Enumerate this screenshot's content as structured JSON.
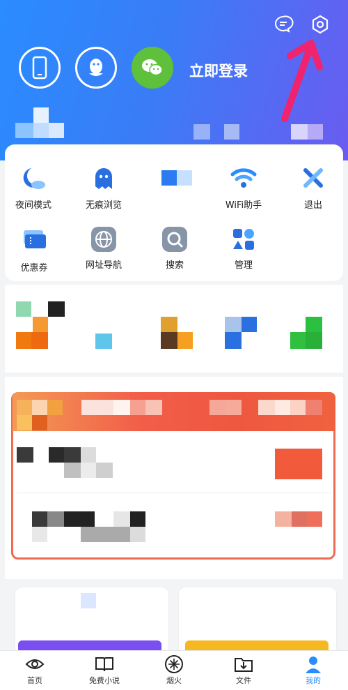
{
  "header": {
    "login_label": "立即登录"
  },
  "tools": [
    {
      "name": "night-mode",
      "label": "夜间模式",
      "icon": "moon-cloud-icon"
    },
    {
      "name": "incognito",
      "label": "无痕浏览",
      "icon": "ghost-icon"
    },
    {
      "name": "blurred",
      "label": "",
      "icon": "blurred-icon"
    },
    {
      "name": "wifi-helper",
      "label": "WiFi助手",
      "icon": "wifi-icon"
    },
    {
      "name": "exit",
      "label": "退出",
      "icon": "close-x-icon"
    },
    {
      "name": "coupons",
      "label": "优惠券",
      "icon": "coupon-icon"
    },
    {
      "name": "url-nav",
      "label": "网址导航",
      "icon": "globe-icon"
    },
    {
      "name": "search",
      "label": "搜索",
      "icon": "search-icon"
    },
    {
      "name": "manage",
      "label": "管理",
      "icon": "manage-icon"
    }
  ],
  "bottom_nav": [
    {
      "name": "home",
      "label": "首页",
      "icon": "eye-icon"
    },
    {
      "name": "free-novels",
      "label": "免费小说",
      "icon": "book-icon"
    },
    {
      "name": "fireworks",
      "label": "烟火",
      "icon": "firework-icon"
    },
    {
      "name": "files",
      "label": "文件",
      "icon": "download-folder-icon"
    },
    {
      "name": "mine",
      "label": "我的",
      "icon": "person-icon"
    }
  ],
  "colors": {
    "accent": "#2a8cff",
    "annotation_arrow": "#f0246e",
    "wechat": "#5ec03b"
  }
}
